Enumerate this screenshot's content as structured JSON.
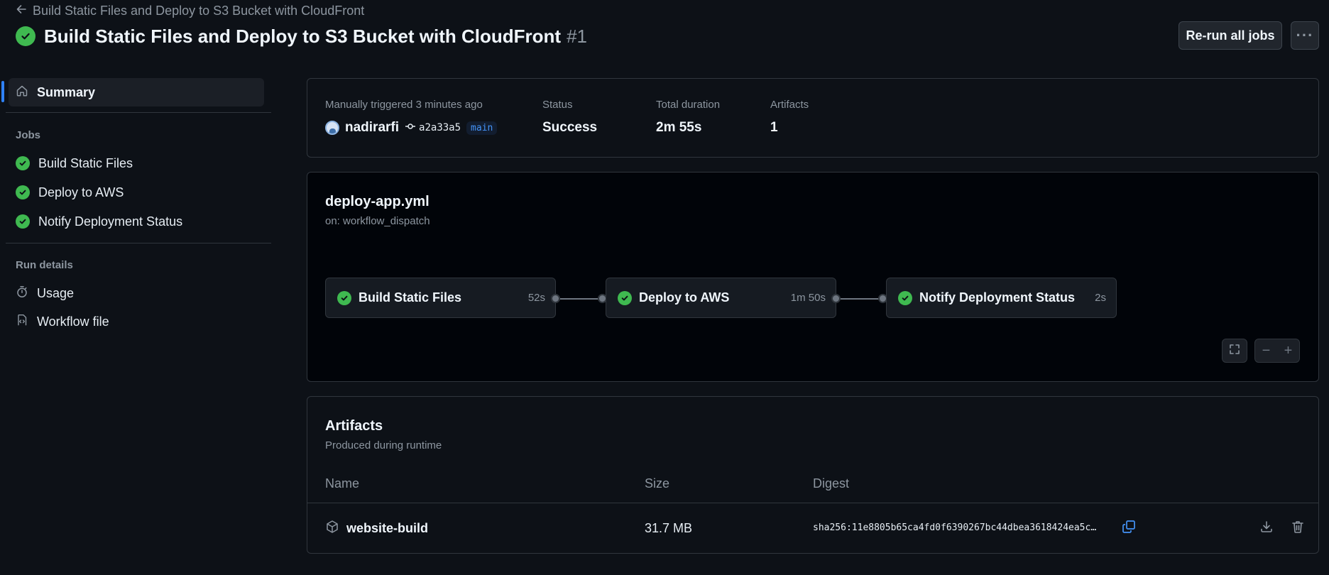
{
  "header": {
    "breadcrumb": "Build Static Files and Deploy to S3 Bucket with CloudFront",
    "title": "Build Static Files and Deploy to S3 Bucket with CloudFront",
    "run_number": "#1",
    "rerun_label": "Re-run all jobs",
    "more_label": "···"
  },
  "sidebar": {
    "summary_label": "Summary",
    "jobs_heading": "Jobs",
    "jobs": [
      {
        "label": "Build Static Files",
        "status": "success"
      },
      {
        "label": "Deploy to AWS",
        "status": "success"
      },
      {
        "label": "Notify Deployment Status",
        "status": "success"
      }
    ],
    "run_details_heading": "Run details",
    "usage_label": "Usage",
    "workflow_file_label": "Workflow file"
  },
  "summary": {
    "trigger_label": "Manually triggered 3 minutes ago",
    "user": "nadirarfi",
    "commit": "a2a33a5",
    "branch": "main",
    "status_label": "Status",
    "status_value": "Success",
    "duration_label": "Total duration",
    "duration_value": "2m 55s",
    "artifacts_label": "Artifacts",
    "artifacts_value": "1"
  },
  "graph": {
    "workflow_file": "deploy-app.yml",
    "trigger": "on: workflow_dispatch",
    "jobs": [
      {
        "name": "Build Static Files",
        "duration": "52s",
        "status": "success"
      },
      {
        "name": "Deploy to AWS",
        "duration": "1m 50s",
        "status": "success"
      },
      {
        "name": "Notify Deployment Status",
        "duration": "2s",
        "status": "success"
      }
    ]
  },
  "artifacts": {
    "title": "Artifacts",
    "subtitle": "Produced during runtime",
    "columns": {
      "name": "Name",
      "size": "Size",
      "digest": "Digest"
    },
    "rows": [
      {
        "name": "website-build",
        "size": "31.7 MB",
        "digest": "sha256:11e8805b65ca4fd0f6390267bc44dbea3618424ea5c…"
      }
    ]
  },
  "colors": {
    "success": "#3fb950",
    "accent": "#2f81f7",
    "background": "#0d1117"
  }
}
